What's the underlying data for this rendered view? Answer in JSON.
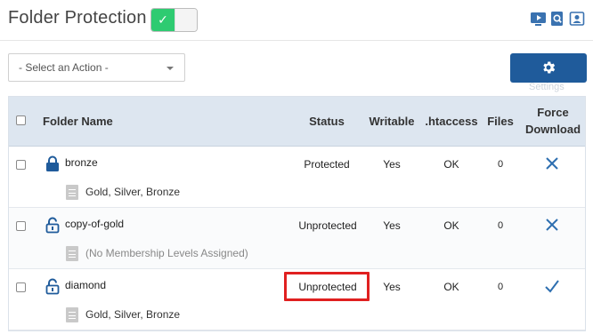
{
  "header": {
    "title": "Folder Protection",
    "toggle_state": "on",
    "icons": [
      "video-tutorial-icon",
      "search-doc-icon",
      "contact-card-icon"
    ]
  },
  "actions": {
    "select_value": "- Select an Action -",
    "settings_label": "Settings",
    "settings_icon": "gear-icon"
  },
  "table": {
    "columns": {
      "folder_name": "Folder Name",
      "status": "Status",
      "writable": "Writable",
      "htaccess": ".htaccess",
      "files": "Files",
      "force_line1": "Force",
      "force_line2": "Download"
    },
    "rows": [
      {
        "name": "bronze",
        "levels": "Gold, Silver, Bronze",
        "status": "Protected",
        "writable": "Yes",
        "htaccess": "OK",
        "files": "0",
        "force_download": "x-icon",
        "lock": "locked"
      },
      {
        "name": "copy-of-gold",
        "levels": "(No Membership Levels Assigned)",
        "status": "Unprotected",
        "writable": "Yes",
        "htaccess": "OK",
        "files": "0",
        "force_download": "x-icon",
        "lock": "unlocked"
      },
      {
        "name": "diamond",
        "levels": "Gold, Silver, Bronze",
        "status": "Unprotected",
        "writable": "Yes",
        "htaccess": "OK",
        "files": "0",
        "force_download": "check-icon",
        "lock": "unlocked"
      }
    ]
  },
  "colors": {
    "toggle_on": "#2ecb71",
    "primary_button": "#1f5b9b",
    "table_header": "#dde6f0",
    "lock_icon": "#1f5b9b",
    "highlight": "#e02020"
  }
}
